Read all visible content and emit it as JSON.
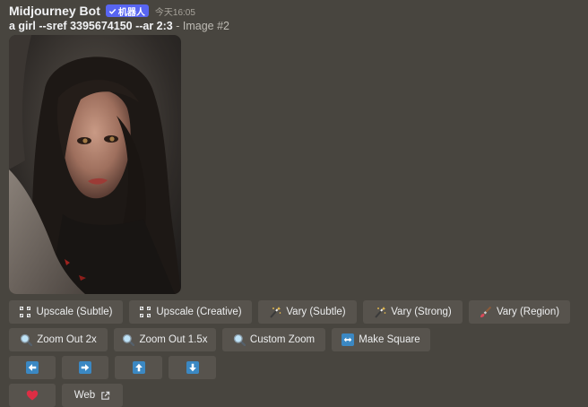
{
  "message": {
    "author": "Midjourney Bot",
    "badge": "机器人",
    "timestamp": "今天16:05",
    "prompt_bold": "a girl --sref 3395674150 --ar 2:3",
    "prompt_suffix": "- Image #2"
  },
  "buttons": {
    "row1": [
      "Upscale (Subtle)",
      "Upscale (Creative)",
      "Vary (Subtle)",
      "Vary (Strong)",
      "Vary (Region)"
    ],
    "row2": [
      "Zoom Out 2x",
      "Zoom Out 1.5x",
      "Custom Zoom",
      "Make Square"
    ],
    "web": "Web"
  },
  "colors": {
    "background": "#48453f",
    "button": "#57534d",
    "badge": "#5865f2",
    "arrow_tile": "#3b88c3",
    "heart": "#dd2e44"
  },
  "icons": {
    "upscale": "expand-corners-icon",
    "vary": "magic-wand-icon",
    "vary_region": "paintbrush-icon",
    "zoom": "magnifier-icon",
    "make_square": "left-right-arrow-icon",
    "arrows": [
      "arrow-left-icon",
      "arrow-right-icon",
      "arrow-up-icon",
      "arrow-down-icon"
    ],
    "like": "heart-icon",
    "external": "external-link-icon"
  }
}
